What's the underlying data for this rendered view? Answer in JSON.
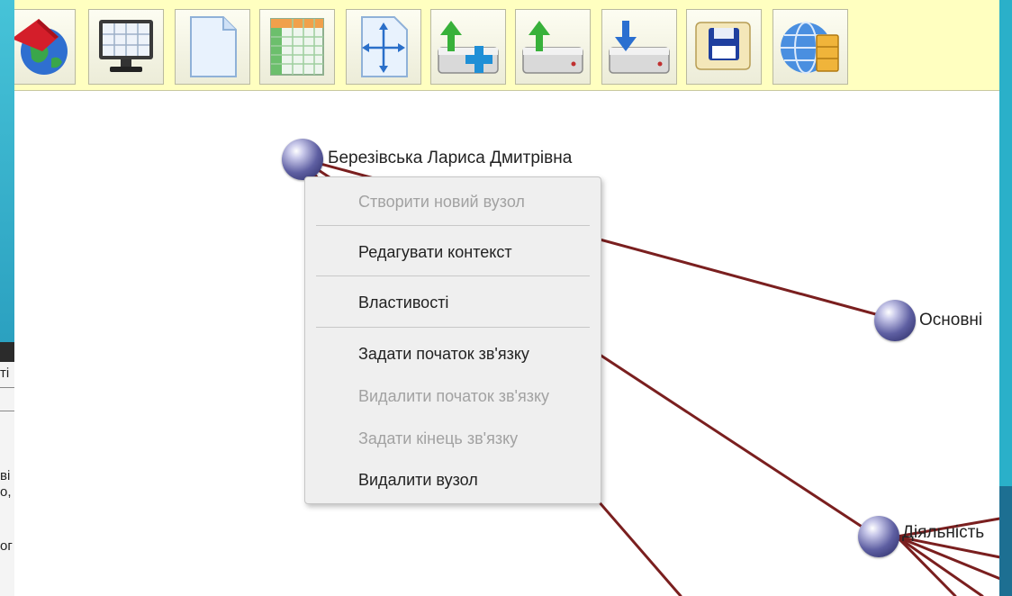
{
  "toolbar": {
    "buttons": [
      {
        "name": "globe-home-button",
        "icon": "globe-house-icon"
      },
      {
        "name": "monitor-button",
        "icon": "monitor-grid-icon"
      },
      {
        "name": "new-page-button",
        "icon": "blank-page-icon"
      },
      {
        "name": "table-button",
        "icon": "spreadsheet-icon"
      },
      {
        "name": "resize-button",
        "icon": "move-arrows-icon"
      },
      {
        "name": "add-upload-button",
        "icon": "drive-upload-plus-icon"
      },
      {
        "name": "upload-button",
        "icon": "drive-upload-icon"
      },
      {
        "name": "download-button",
        "icon": "drive-download-icon"
      },
      {
        "name": "save-button",
        "icon": "floppy-scroll-icon"
      },
      {
        "name": "web-folder-button",
        "icon": "globe-cabinet-icon"
      }
    ]
  },
  "graph": {
    "nodes": [
      {
        "label": "Березівська Лариса Дмитрівна"
      },
      {
        "label": "Основні"
      },
      {
        "label": "Діяльність"
      }
    ],
    "edge_color": "#7a1f1f"
  },
  "context_menu": {
    "items": [
      {
        "label": "Створити новий вузол",
        "enabled": false
      },
      {
        "label": "Редагувати контекст",
        "enabled": true
      },
      {
        "label": "Властивості",
        "enabled": true
      },
      {
        "label": "Задати початок зв'язку",
        "enabled": true
      },
      {
        "label": "Видалити початок зв'язку",
        "enabled": false
      },
      {
        "label": "Задати кінець зв'язку",
        "enabled": false
      },
      {
        "label": "Видалити вузол",
        "enabled": true
      }
    ]
  },
  "side_window": {
    "fragments": [
      "ті",
      "ві",
      "о,",
      "ог"
    ]
  }
}
